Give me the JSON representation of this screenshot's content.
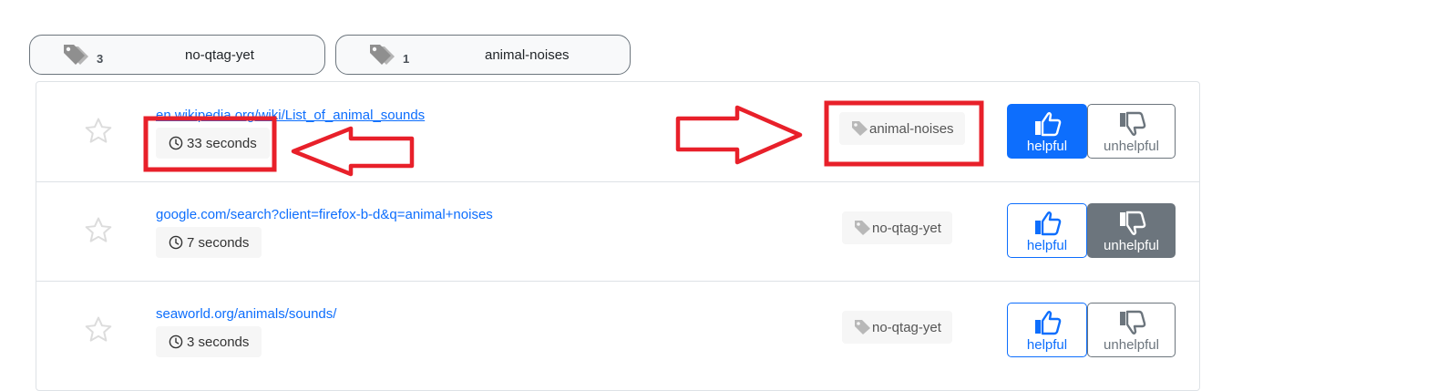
{
  "tag_filters": [
    {
      "count": "3",
      "label": "no-qtag-yet"
    },
    {
      "count": "1",
      "label": "animal-noises"
    }
  ],
  "results": [
    {
      "url": "en.wikipedia.org/wiki/List_of_animal_sounds",
      "time": "33 seconds",
      "tag": "animal-noises",
      "helpful_label": "helpful",
      "unhelpful_label": "unhelpful",
      "vote": "helpful"
    },
    {
      "url": "google.com/search?client=firefox-b-d&q=animal+noises",
      "time": "7 seconds",
      "tag": "no-qtag-yet",
      "helpful_label": "helpful",
      "unhelpful_label": "unhelpful",
      "vote": "unhelpful"
    },
    {
      "url": "seaworld.org/animals/sounds/",
      "time": "3 seconds",
      "tag": "no-qtag-yet",
      "helpful_label": "helpful",
      "unhelpful_label": "unhelpful",
      "vote": "none"
    }
  ],
  "icons": {
    "star": "star-outline-icon",
    "clock": "clock-icon",
    "tag": "tag-icon",
    "tags": "tags-icon",
    "thumbs_up": "thumbs-up-icon",
    "thumbs_down": "thumbs-down-icon"
  },
  "colors": {
    "primary": "#0d6efd",
    "secondary": "#6c757d",
    "annotation": "#e8202a"
  }
}
